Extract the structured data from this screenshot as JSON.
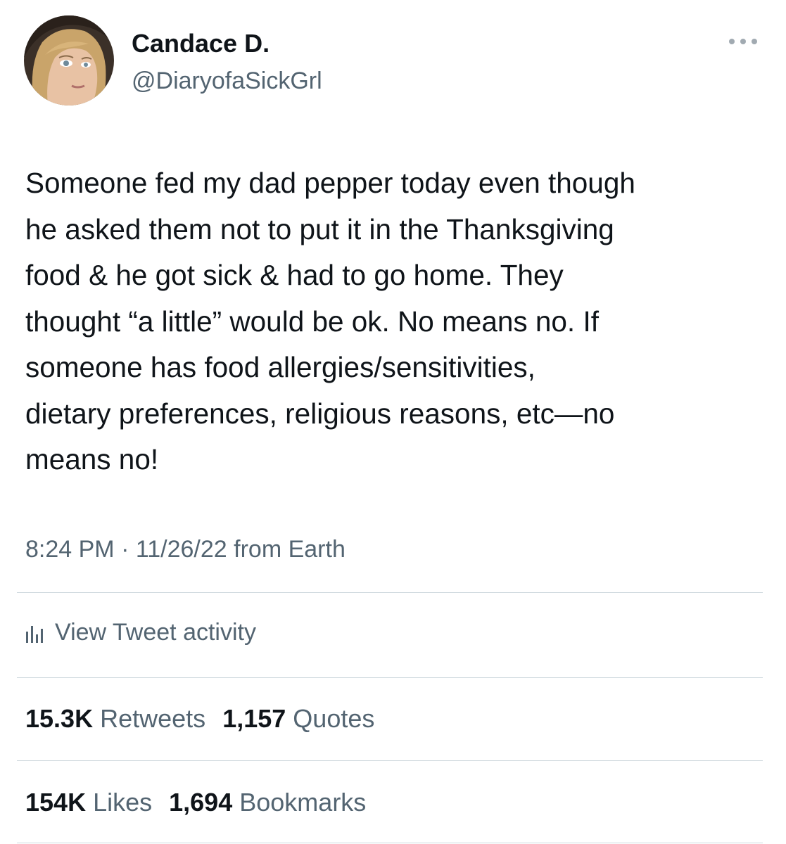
{
  "author": {
    "display_name": "Candace D.",
    "handle": "@DiaryofaSickGrl",
    "avatar_icon": "profile-photo"
  },
  "more_icon": "more-horizontal-icon",
  "tweet": {
    "text": "Someone fed my dad pepper today even though\nhe asked them not to put it in the Thanksgiving\nfood & he got sick & had to go home. They\nthought “a little” would be ok. No means no. If\nsomeone has food allergies/sensitivities,\ndietary preferences, religious reasons, etc—no\nmeans no!",
    "time": "8:24 PM",
    "separator": "·",
    "date": "11/26/22",
    "source": "from Earth"
  },
  "activity": {
    "icon": "analytics-bar-icon",
    "label": "View Tweet activity"
  },
  "stats": {
    "retweets": {
      "value": "15.3K",
      "label": "Retweets"
    },
    "quotes": {
      "value": "1,157",
      "label": "Quotes"
    },
    "likes": {
      "value": "154K",
      "label": "Likes"
    },
    "bookmarks": {
      "value": "1,694",
      "label": "Bookmarks"
    }
  },
  "colors": {
    "text_primary": "#0f1419",
    "text_secondary": "#536471",
    "divider": "#cfd9de"
  }
}
